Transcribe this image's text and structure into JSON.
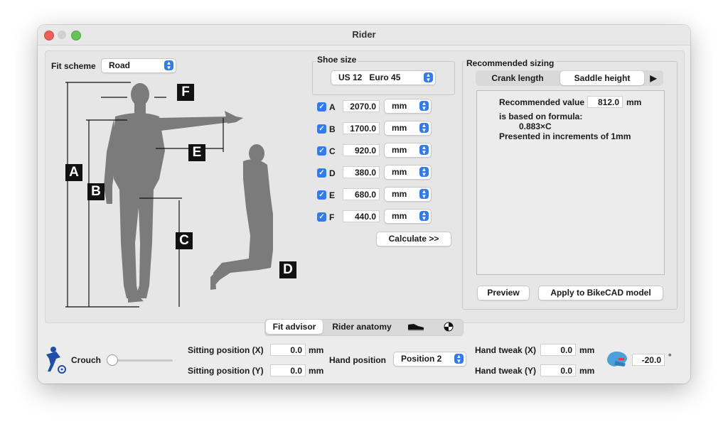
{
  "window": {
    "title": "Rider"
  },
  "fit_scheme": {
    "label": "Fit scheme",
    "value": "Road"
  },
  "shoe": {
    "label": "Shoe size",
    "value": "US 12   Euro 45"
  },
  "measurements": [
    {
      "letter": "A",
      "value": "2070.0",
      "unit": "mm"
    },
    {
      "letter": "B",
      "value": "1700.0",
      "unit": "mm"
    },
    {
      "letter": "C",
      "value": "920.0",
      "unit": "mm"
    },
    {
      "letter": "D",
      "value": "380.0",
      "unit": "mm"
    },
    {
      "letter": "E",
      "value": "680.0",
      "unit": "mm"
    },
    {
      "letter": "F",
      "value": "440.0",
      "unit": "mm"
    }
  ],
  "calculate_label": "Calculate >>",
  "figure_letters": {
    "A": "A",
    "B": "B",
    "C": "C",
    "D": "D",
    "E": "E",
    "F": "F"
  },
  "recommended": {
    "title": "Recommended sizing",
    "tabs": [
      "Crank length",
      "Saddle height"
    ],
    "more": "▶",
    "value_label": "Recommended value",
    "value": "812.0",
    "unit": "mm",
    "formula_label": "is based on formula:",
    "formula": "0.883×C",
    "increments": "Presented in increments of 1mm",
    "preview_label": "Preview",
    "apply_label": "Apply to BikeCAD model"
  },
  "bottom_tabs": {
    "fit_advisor": "Fit advisor",
    "rider_anatomy": "Rider anatomy"
  },
  "crouch": {
    "label": "Crouch",
    "level": 0
  },
  "sitting_x": {
    "label": "Sitting position (X)",
    "value": "0.0",
    "unit": "mm"
  },
  "sitting_y": {
    "label": "Sitting position (Y)",
    "value": "0.0",
    "unit": "mm"
  },
  "hand_position": {
    "label": "Hand position",
    "value": "Position 2"
  },
  "hand_tweak_x": {
    "label": "Hand tweak (X)",
    "value": "0.0",
    "unit": "mm"
  },
  "hand_tweak_y": {
    "label": "Hand tweak (Y)",
    "value": "0.0",
    "unit": "mm"
  },
  "head_angle": {
    "value": "-20.0",
    "unit": "°"
  }
}
